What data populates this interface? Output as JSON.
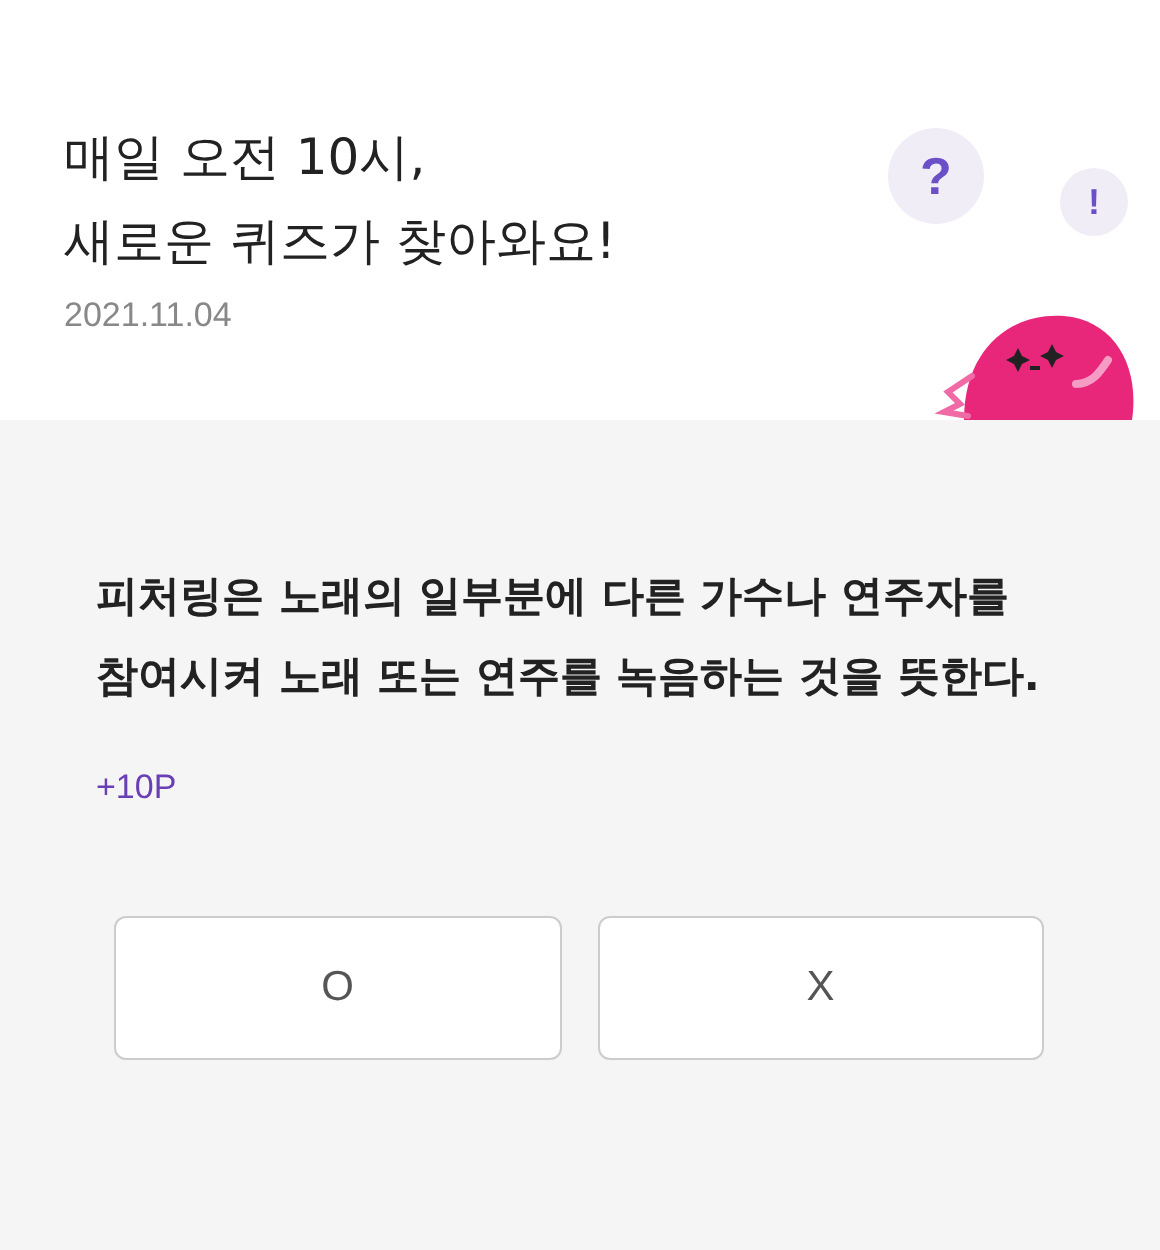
{
  "header": {
    "title_lines": [
      "매일 오전 10시,",
      "새로운 퀴즈가 찾아와요!"
    ],
    "date": "2021.11.04",
    "bubbles": [
      "?",
      "!"
    ]
  },
  "quiz": {
    "question": "피처링은 노래의 일부분에 다른 가수나 연주자를 참여시켜 노래 또는 연주를 녹음하는 것을 뜻한다.",
    "points": "+10P",
    "answers": [
      {
        "label": "O"
      },
      {
        "label": "X"
      }
    ]
  }
}
